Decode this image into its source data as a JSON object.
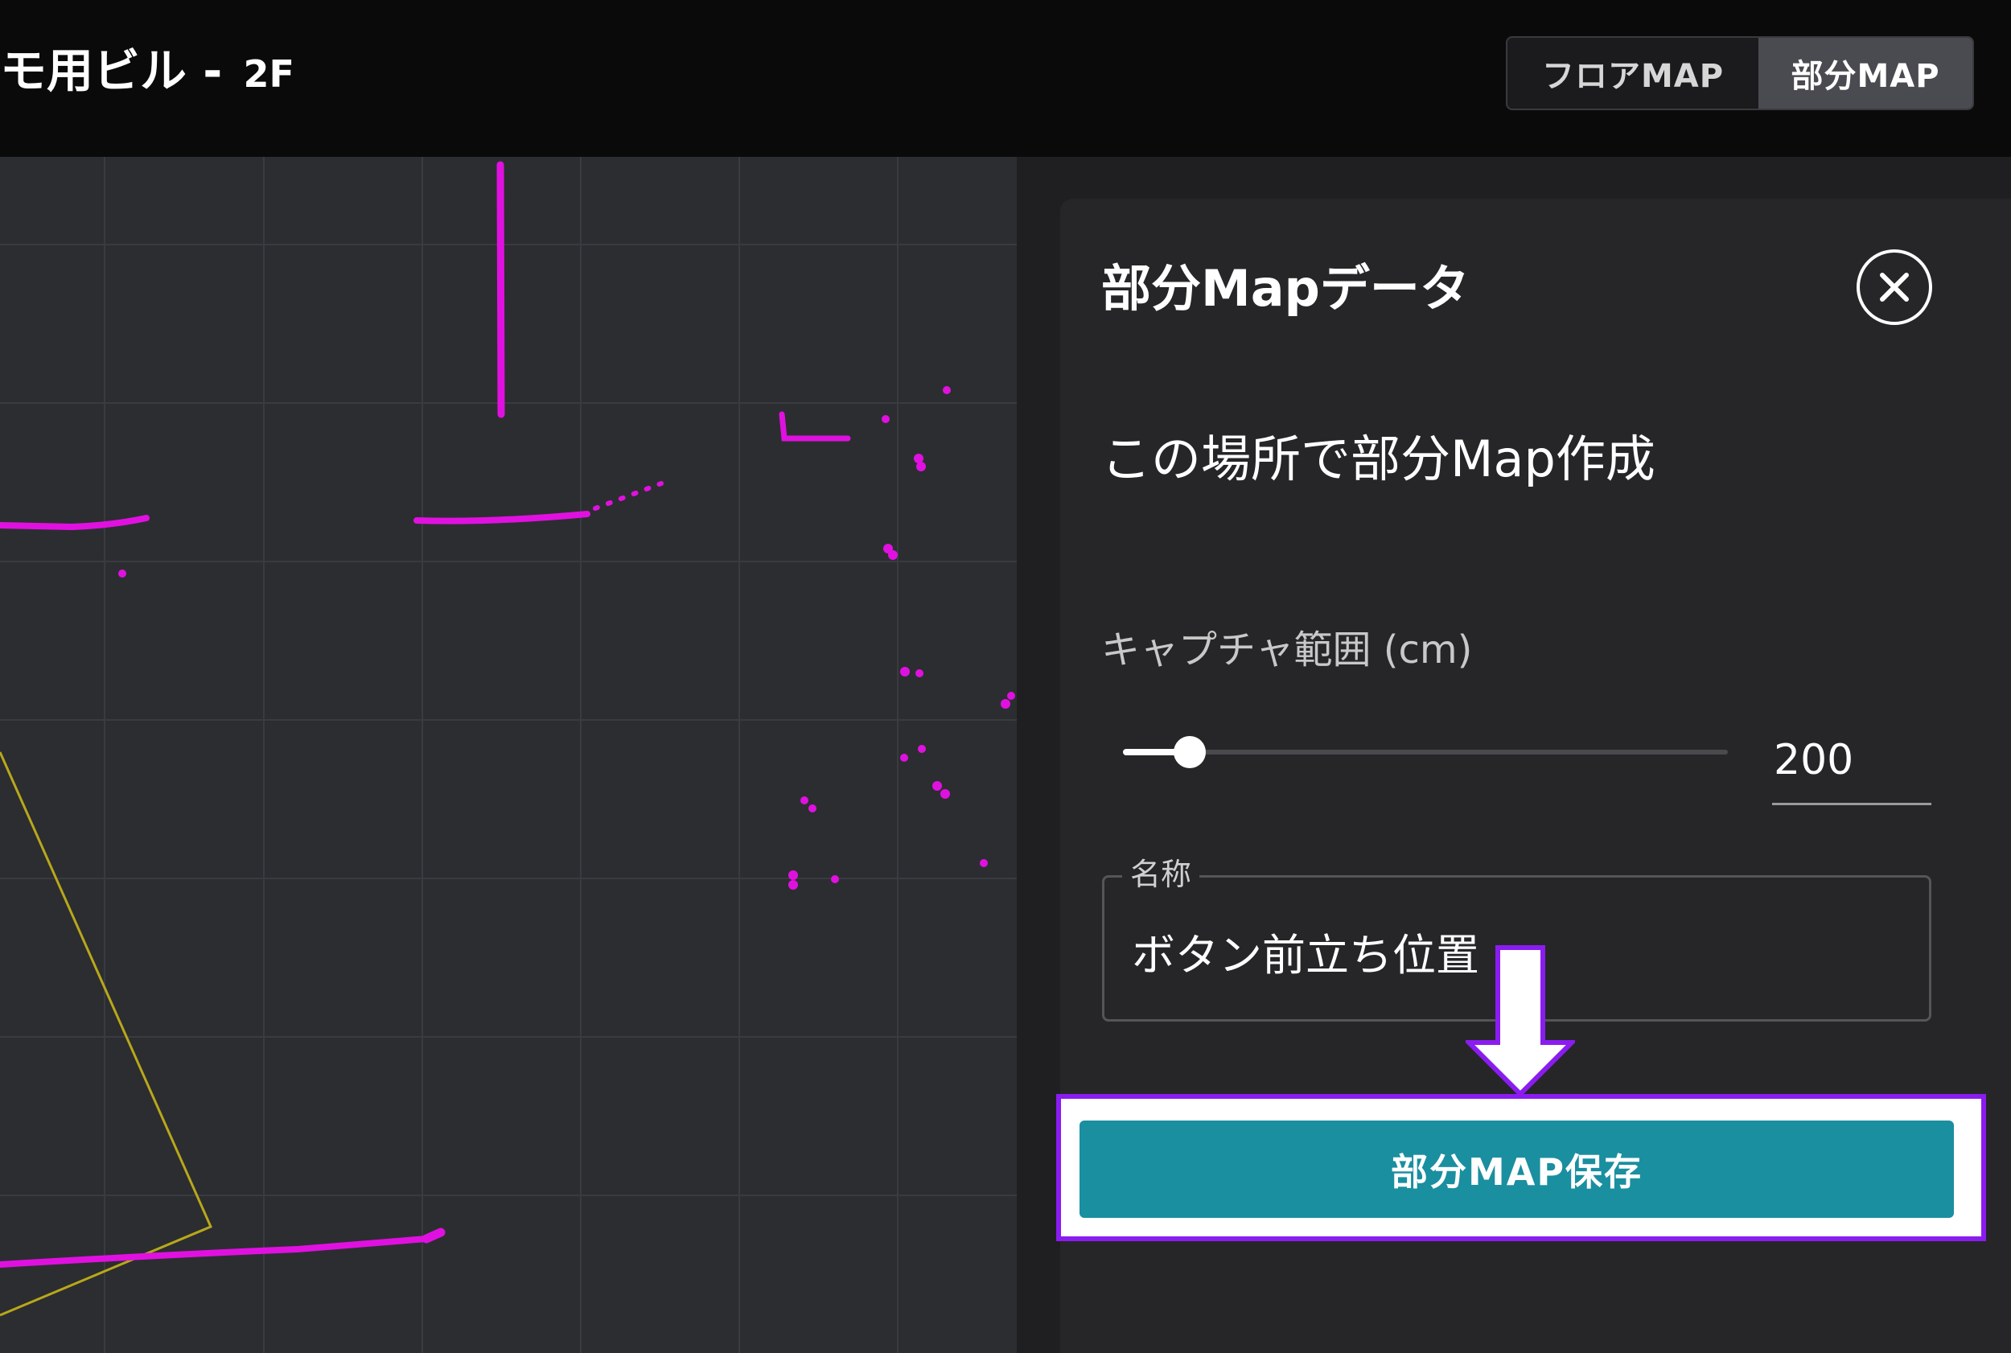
{
  "header": {
    "title": "モ用ビル - ",
    "floor": "2F",
    "toggle": {
      "floor_map_label": "フロアMAP",
      "part_map_label": "部分MAP",
      "selected": "部分MAP"
    }
  },
  "map": {
    "colors": {
      "background": "#2c2d31",
      "grid": "#3a3b40",
      "scan_points": "#e011e0",
      "robot_outline": "#b8a81a"
    }
  },
  "panel": {
    "title": "部分Mapデータ",
    "close_icon": "close-icon",
    "section_heading": "この場所で部分Map作成",
    "capture_range": {
      "label": "キャプチャ範囲 (cm)",
      "value": "200",
      "fraction": 0.11
    },
    "name_field": {
      "legend": "名称",
      "value": "ボタン前立ち位置"
    },
    "save_button_label": "部分MAP保存"
  },
  "annotation": {
    "arrow_icon": "down-arrow-icon",
    "highlight_color": "#8a1cf0",
    "button_color": "#1a8fa0"
  }
}
